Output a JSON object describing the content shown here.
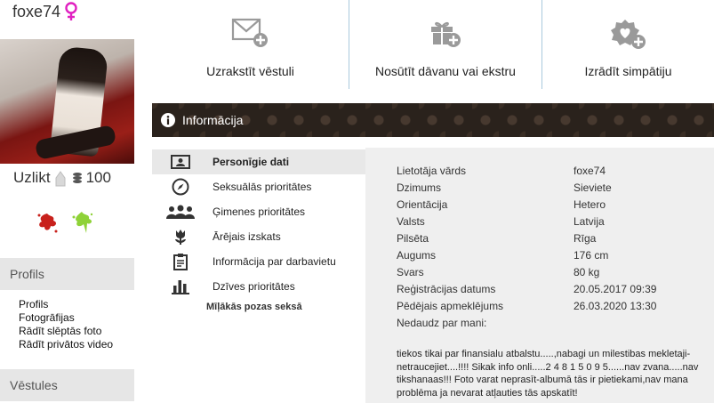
{
  "profile": {
    "username": "foxe74",
    "uzlikt_label": "Uzlikt",
    "coins": "100"
  },
  "actions": {
    "write_message": "Uzrakstīt vēstuli",
    "send_gift": "Nosūtīt dāvanu vai ekstru",
    "show_sympathy": "Izrādīt simpātiju"
  },
  "sidebar": {
    "profile_section": "Profils",
    "links": [
      "Profils",
      "Fotogrāfijas",
      "Rādīt slēptās foto",
      "Rādīt privātos video"
    ],
    "messages_section": "Vēstules"
  },
  "banner": {
    "title": "Informācija"
  },
  "tabs": [
    {
      "label": "Personīgie dati",
      "icon": "id-card-icon"
    },
    {
      "label": "Seksuālās prioritātes",
      "icon": "compass-icon"
    },
    {
      "label": "Ģimenes prioritātes",
      "icon": "family-icon"
    },
    {
      "label": "Ārējais izskats",
      "icon": "flower-icon"
    },
    {
      "label": "Informācija par darbavietu",
      "icon": "clipboard-icon"
    },
    {
      "label": "Dzīves prioritātes",
      "icon": "bar-chart-icon"
    }
  ],
  "sub_link": "Mīļākās pozas seksā",
  "details": [
    {
      "key": "Lietotāja vārds",
      "value": "foxe74"
    },
    {
      "key": "Dzimums",
      "value": "Sieviete"
    },
    {
      "key": "Orientācija",
      "value": "Hetero"
    },
    {
      "key": "Valsts",
      "value": "Latvija"
    },
    {
      "key": "Pilsēta",
      "value": "Rīga"
    },
    {
      "key": "Augums",
      "value": "176 cm"
    },
    {
      "key": "Svars",
      "value": "80 kg"
    },
    {
      "key": "Reģistrācijas datums",
      "value": "20.05.2017 09:39"
    },
    {
      "key": "Pēdējais apmeklējums",
      "value": "26.03.2020 13:30"
    }
  ],
  "about": {
    "label": "Nedaudz par mani:",
    "text": "tiekos tikai par finansialu atbalstu.....,nabagi un milestibas mekletaji-netraucejiet....!!!! Sikak info onli.....2 4 8 1 5 0 9 5......nav zvana.....nav tikshanaas!!! Foto varat neprasīt-albumā tās ir pietiekami,nav mana problēma ja nevarat atļauties tās apskatīt!"
  },
  "colors": {
    "female_symbol": "#e020c0",
    "banner_bg": "#2a221c",
    "separator": "#a9c9dc",
    "panel_bg": "#efefef"
  }
}
